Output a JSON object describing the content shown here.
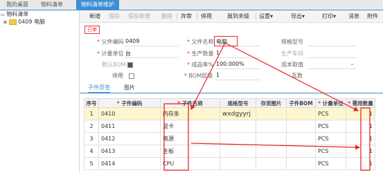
{
  "tabs": [
    {
      "label": "我的桌面"
    },
    {
      "label": "物料清单"
    },
    {
      "label": "物料清单维护",
      "active": true
    }
  ],
  "tree": {
    "root": "物料清单",
    "child": "0409 电脑"
  },
  "toolbar": [
    "新增",
    "保存",
    "保存新增",
    "删除",
    "弃审",
    "停用",
    "展到末级",
    "设置▾",
    "导出▾",
    "打印▾",
    "消息",
    "附件"
  ],
  "status_badge": "已审",
  "form": {
    "parent_code_label": "父件编码",
    "parent_code": "0409",
    "parent_name_label": "父件名称",
    "parent_name": "电脑",
    "spec_label": "规格型号",
    "unit_label": "计量单位",
    "unit": "台",
    "qty_label": "生产数量",
    "qty": "1",
    "workshop_label": "生产车间",
    "default_bom_label": "默认BOM",
    "yield_label": "成品率%",
    "yield": "100.000%",
    "cost_label": "成本取值",
    "disabled_label": "停用",
    "bom_level_label": "BOM层级",
    "bom_level": "1",
    "scrap_label": "瓦数"
  },
  "subtabs": [
    "子件页签",
    "图片"
  ],
  "grid": {
    "headers": [
      "序号",
      "子件编码",
      "子件名称",
      "规格型号",
      "存货图片",
      "子件BOM",
      "计量单位",
      "需用数量"
    ],
    "rows": [
      {
        "no": "1",
        "code": "0410",
        "name": "内存条",
        "spec": "wxdgyyrj",
        "unit": "PCS",
        "qty": "1"
      },
      {
        "no": "2",
        "code": "0411",
        "name": "显卡",
        "spec": "",
        "unit": "PCS",
        "qty": "1"
      },
      {
        "no": "3",
        "code": "0412",
        "name": "电源",
        "spec": "",
        "unit": "PCS",
        "qty": "1"
      },
      {
        "no": "4",
        "code": "0413",
        "name": "主板",
        "spec": "",
        "unit": "PCS",
        "qty": "1"
      },
      {
        "no": "5",
        "code": "0414",
        "name": "CPU",
        "spec": "",
        "unit": "PCS",
        "qty": "1"
      }
    ]
  }
}
